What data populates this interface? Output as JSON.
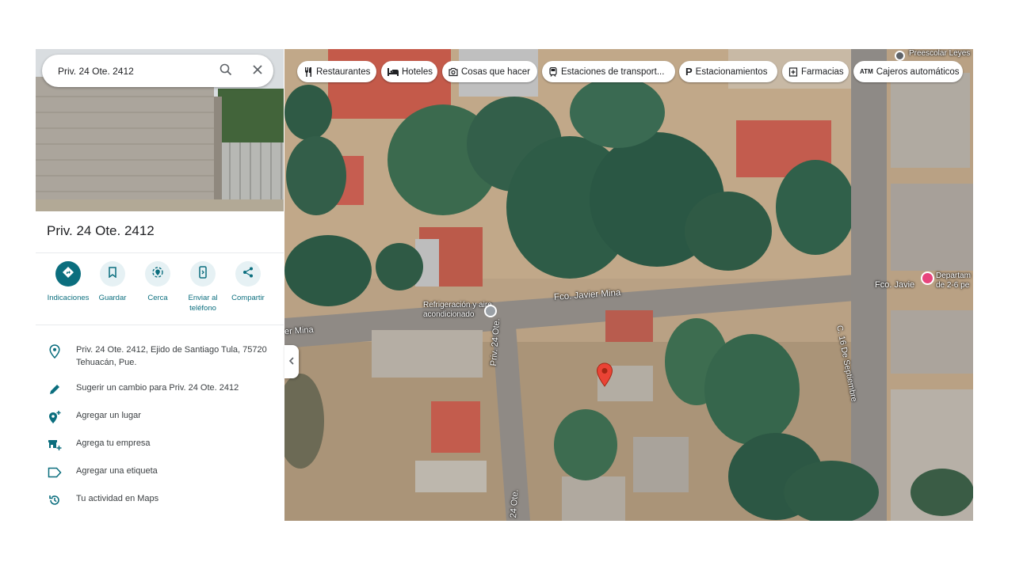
{
  "search": {
    "value": "Priv. 24 Ote. 2412"
  },
  "place": {
    "title": "Priv. 24 Ote. 2412"
  },
  "actions": [
    {
      "label": "Indicaciones"
    },
    {
      "label": "Guardar"
    },
    {
      "label": "Cerca"
    },
    {
      "label": "Enviar al teléfono"
    },
    {
      "label": "Compartir"
    }
  ],
  "info": {
    "address_line1": "Priv. 24 Ote. 2412, Ejido de Santiago Tula, 75720",
    "address_line2": "Tehuacán, Pue.",
    "suggest": "Sugerir un cambio para Priv. 24 Ote. 2412",
    "add_place": "Agregar un lugar",
    "add_business": "Agrega tu empresa",
    "add_label": "Agregar una etiqueta",
    "activity": "Tu actividad en Maps"
  },
  "chips": [
    {
      "label": "Restaurantes",
      "icon": "fork-knife-icon"
    },
    {
      "label": "Hoteles",
      "icon": "bed-icon"
    },
    {
      "label": "Cosas que hacer",
      "icon": "camera-icon"
    },
    {
      "label": "Estaciones de transport...",
      "icon": "train-icon"
    },
    {
      "label": "Estacionamientos",
      "icon": "parking-icon"
    },
    {
      "label": "Farmacias",
      "icon": "pharmacy-icon"
    },
    {
      "label": "Cajeros automáticos",
      "icon": "atm-icon"
    }
  ],
  "map_labels": {
    "street_main": "Fco. Javier Mina",
    "street_main_left": "er Mina",
    "street_main_right": "Fco. Javie",
    "street_priv": "Priv. 24 Ote.",
    "street_24": "24 Ote.",
    "street_sept": "C. 16 De Septiembre",
    "poi_refrig": "Refrigeración y aire acondicionado",
    "poi_dept": "Departam de 2-6 pe",
    "poi_school": "Preescolar Leyes"
  },
  "colors": {
    "accent": "#0b6e7e",
    "pin": "#ea4335",
    "poi_pink": "#e8457c"
  }
}
